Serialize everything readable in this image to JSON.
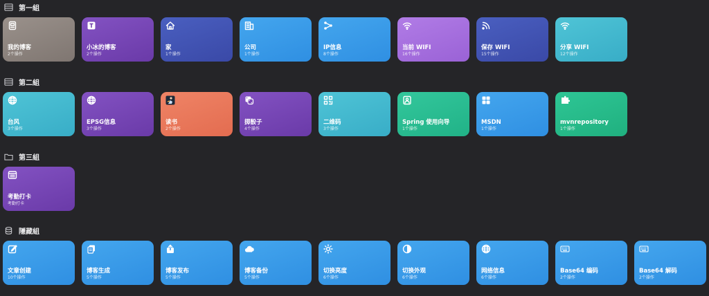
{
  "groups": [
    {
      "name": "第一組",
      "icon": "list-icon",
      "cards": [
        {
          "title": "我的博客",
          "sub": "2个操作",
          "icon": "document-icon",
          "color": "gray"
        },
        {
          "title": "小冰的博客",
          "sub": "2个操作",
          "icon": "text-t-icon",
          "color": "purple"
        },
        {
          "title": "家",
          "sub": "1个操作",
          "icon": "house-icon",
          "color": "indigo"
        },
        {
          "title": "公司",
          "sub": "1个操作",
          "icon": "building-icon",
          "color": "blue"
        },
        {
          "title": "IP信息",
          "sub": "8个操作",
          "icon": "share-nodes-icon",
          "color": "blue"
        },
        {
          "title": "当前 WIFI",
          "sub": "16个操作",
          "icon": "wifi-icon",
          "color": "violet"
        },
        {
          "title": "保存 WIFI",
          "sub": "15个操作",
          "icon": "rss-icon",
          "color": "indigo"
        },
        {
          "title": "分享 WIFI",
          "sub": "12个操作",
          "icon": "wifi-icon",
          "color": "cyan"
        }
      ]
    },
    {
      "name": "第二組",
      "icon": "list-icon",
      "cards": [
        {
          "title": "台风",
          "sub": "3个操作",
          "icon": "globe-icon",
          "color": "cyan"
        },
        {
          "title": "EPSG信息",
          "sub": "3个操作",
          "icon": "globe-icon",
          "color": "purple"
        },
        {
          "title": "读书",
          "sub": "2个操作",
          "icon": "reader-icon",
          "color": "orange"
        },
        {
          "title": "掷骰子",
          "sub": "4个操作",
          "icon": "dice-icon",
          "color": "purple"
        },
        {
          "title": "二维码",
          "sub": "3个操作",
          "icon": "qrcode-icon",
          "color": "cyan"
        },
        {
          "title": "Spring 使用向导",
          "sub": "1个操作",
          "icon": "image-icon",
          "color": "teal"
        },
        {
          "title": "MSDN",
          "sub": "1个操作",
          "icon": "grid-icon",
          "color": "blue"
        },
        {
          "title": "mvnrepository",
          "sub": "1个操作",
          "icon": "puzzle-icon",
          "color": "green"
        }
      ]
    },
    {
      "name": "第三組",
      "icon": "folder-icon",
      "cards": [
        {
          "title": "考勤打卡",
          "sub": "考勤打卡",
          "icon": "notes-icon",
          "color": "purple"
        }
      ]
    },
    {
      "name": "隱藏組",
      "icon": "stack-icon",
      "cards": [
        {
          "title": "文章创建",
          "sub": "10个操作",
          "icon": "edit-icon",
          "color": "blue"
        },
        {
          "title": "博客生成",
          "sub": "5个操作",
          "icon": "copy-icon",
          "color": "blue"
        },
        {
          "title": "博客发布",
          "sub": "5个操作",
          "icon": "upload-icon",
          "color": "blue"
        },
        {
          "title": "博客备份",
          "sub": "5个操作",
          "icon": "cloud-icon",
          "color": "blue"
        },
        {
          "title": "切换亮度",
          "sub": "6个操作",
          "icon": "sun-icon",
          "color": "blue"
        },
        {
          "title": "切换外观",
          "sub": "6个操作",
          "icon": "appearance-icon",
          "color": "blue"
        },
        {
          "title": "网络信息",
          "sub": "6个操作",
          "icon": "globe-icon",
          "color": "blue"
        },
        {
          "title": "Base64 编码",
          "sub": "2个操作",
          "icon": "keyboard-icon",
          "color": "blue"
        },
        {
          "title": "Base64 解码",
          "sub": "2个操作",
          "icon": "keyboard-icon",
          "color": "blue"
        }
      ]
    }
  ]
}
